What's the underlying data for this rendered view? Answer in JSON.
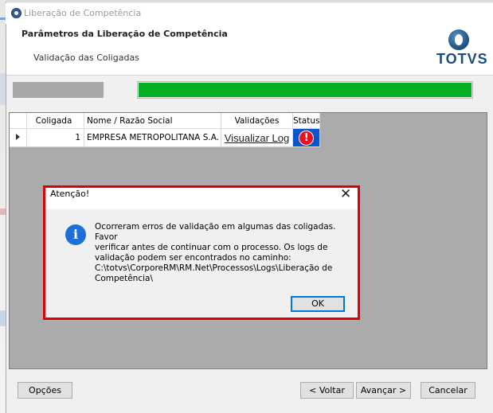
{
  "window": {
    "title": "Liberação de Competência"
  },
  "header": {
    "title": "Parâmetros da Liberação de Competência",
    "subtitle": "Validação das Coligadas",
    "logo_text": "TOTVS"
  },
  "progress": {
    "value": 1.0,
    "color": "#06b025"
  },
  "grid": {
    "columns": [
      "Coligada",
      "Nome / Razão Social",
      "Validações",
      "Status"
    ],
    "rows": [
      {
        "coligada": "1",
        "nome": "EMPRESA METROPOLITANA S.A.",
        "validacoes": "Visualizar Log",
        "status_icon": "error-icon"
      }
    ]
  },
  "dialog": {
    "title": "Atenção!",
    "close_glyph": "✕",
    "icon": "info-icon",
    "message": "Ocorreram erros de validação em algumas das coligadas. Favor\nverificar antes de continuar com o processo. Os logs de\nvalidação podem ser encontrados no caminho:\nC:\\totvs\\CorporeRM\\RM.Net\\Processos\\Logs\\Liberação de\nCompetência\\",
    "ok_label": "OK"
  },
  "footer": {
    "options_label": "Opções",
    "back_label": "< Voltar",
    "next_label": "Avançar >",
    "cancel_label": "Cancelar"
  }
}
